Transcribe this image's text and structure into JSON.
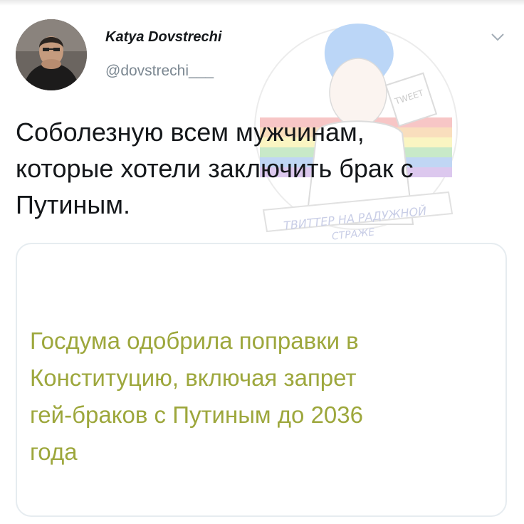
{
  "tweet": {
    "author_name": "Katya Dovstrechi",
    "author_handle": "@dovstrechi___",
    "menu_icon": "chevron-down-icon",
    "text_lines": [
      "Соболезную всем мужчинам,",
      "которые хотели заключить брак с",
      "Путиным."
    ]
  },
  "card": {
    "text_lines": [
      "Госдума одобрила поправки в",
      "Конституцию, включая запрет",
      "гей-браков с Путиным до 2036",
      "года"
    ]
  },
  "watermark": {
    "banner_line1": "ТВИТТЕР НА РАДУЖНОЙ",
    "banner_line2": "СТРАЖЕ",
    "sign_text": "TWEET"
  },
  "colors": {
    "handle": "#7b8791",
    "text": "#14171a",
    "card_text": "#9da73c",
    "card_border": "#e6ecf0"
  }
}
